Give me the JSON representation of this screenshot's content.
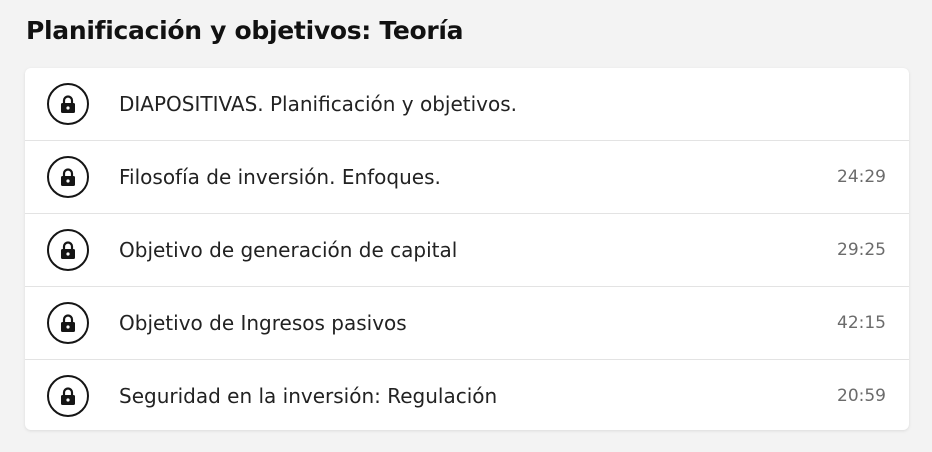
{
  "section": {
    "title": "Planificación y objetivos: Teoría"
  },
  "lessons": [
    {
      "title": "DIAPOSITIVAS. Planificación y objetivos.",
      "duration": "",
      "icon": "lock-icon"
    },
    {
      "title": "Filosofía de inversión. Enfoques.",
      "duration": "24:29",
      "icon": "lock-icon"
    },
    {
      "title": "Objetivo de generación de capital",
      "duration": "29:25",
      "icon": "lock-icon"
    },
    {
      "title": "Objetivo de Ingresos pasivos",
      "duration": "42:15",
      "icon": "lock-icon"
    },
    {
      "title": "Seguridad en la inversión: Regulación",
      "duration": "20:59",
      "icon": "lock-icon"
    }
  ],
  "colors": {
    "background": "#f3f3f3",
    "card": "#ffffff",
    "text": "#222222",
    "muted": "#6b6b6b",
    "divider": "#e3e3e3"
  }
}
